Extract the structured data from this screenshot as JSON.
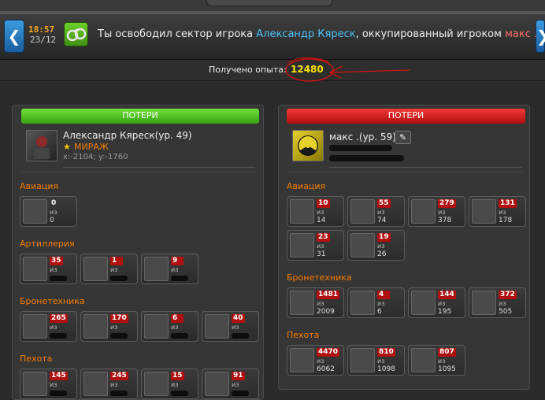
{
  "header": {
    "time": "18:57",
    "date": "23/12",
    "message_before": "Ты освободил сектор игрока ",
    "player1": "Александр Кяреск",
    "message_middle": ", оккупированный игроком ",
    "player2": "макс .",
    "left_arrow": "❮",
    "right_arrow": "❯"
  },
  "experience": {
    "label": "Получено опыта:",
    "value": "12480"
  },
  "colors": {
    "win_header": "#4caf1a",
    "loss_header": "#d01515",
    "category": "#f57c00",
    "experience": "#f9e400",
    "count_badge": "#b01010"
  },
  "left_panel": {
    "header": "ПОТЕРИ",
    "player_name": "Александр Кяреск(ур. 49)",
    "alliance": "МИРАЖ",
    "coords": "x:-2104; y:-1760",
    "categories": [
      {
        "name": "Авиация",
        "units": [
          {
            "lost": "0",
            "of": "из",
            "total": "0"
          }
        ]
      },
      {
        "name": "Артиллерия",
        "units": [
          {
            "lost": "35",
            "of": "из",
            "total": ""
          },
          {
            "lost": "1",
            "of": "из",
            "total": ""
          },
          {
            "lost": "9",
            "of": "из",
            "total": ""
          }
        ]
      },
      {
        "name": "Бронетехника",
        "units": [
          {
            "lost": "265",
            "of": "из",
            "total": ""
          },
          {
            "lost": "170",
            "of": "из",
            "total": ""
          },
          {
            "lost": "6",
            "of": "из",
            "total": ""
          },
          {
            "lost": "40",
            "of": "из",
            "total": ""
          }
        ]
      },
      {
        "name": "Пехота",
        "units": [
          {
            "lost": "145",
            "of": "из",
            "total": ""
          },
          {
            "lost": "245",
            "of": "из",
            "total": ""
          },
          {
            "lost": "15",
            "of": "из",
            "total": ""
          },
          {
            "lost": "91",
            "of": "из",
            "total": ""
          }
        ]
      }
    ]
  },
  "right_panel": {
    "header": "ПОТЕРИ",
    "player_name": "макс .(ур. 59)",
    "categories": [
      {
        "name": "Авиация",
        "units": [
          {
            "lost": "10",
            "of": "из",
            "total": "14"
          },
          {
            "lost": "55",
            "of": "из",
            "total": "74"
          },
          {
            "lost": "279",
            "of": "из",
            "total": "378"
          },
          {
            "lost": "131",
            "of": "из",
            "total": "178"
          },
          {
            "lost": "23",
            "of": "из",
            "total": "31"
          },
          {
            "lost": "19",
            "of": "из",
            "total": "26"
          }
        ]
      },
      {
        "name": "Бронетехника",
        "units": [
          {
            "lost": "1481",
            "of": "из",
            "total": "2009"
          },
          {
            "lost": "4",
            "of": "из",
            "total": "6"
          },
          {
            "lost": "144",
            "of": "из",
            "total": "195"
          },
          {
            "lost": "372",
            "of": "из",
            "total": "505"
          }
        ]
      },
      {
        "name": "Пехота",
        "units": [
          {
            "lost": "4470",
            "of": "из",
            "total": "6062"
          },
          {
            "lost": "810",
            "of": "из",
            "total": "1098"
          },
          {
            "lost": "807",
            "of": "из",
            "total": "1095"
          }
        ]
      }
    ]
  }
}
